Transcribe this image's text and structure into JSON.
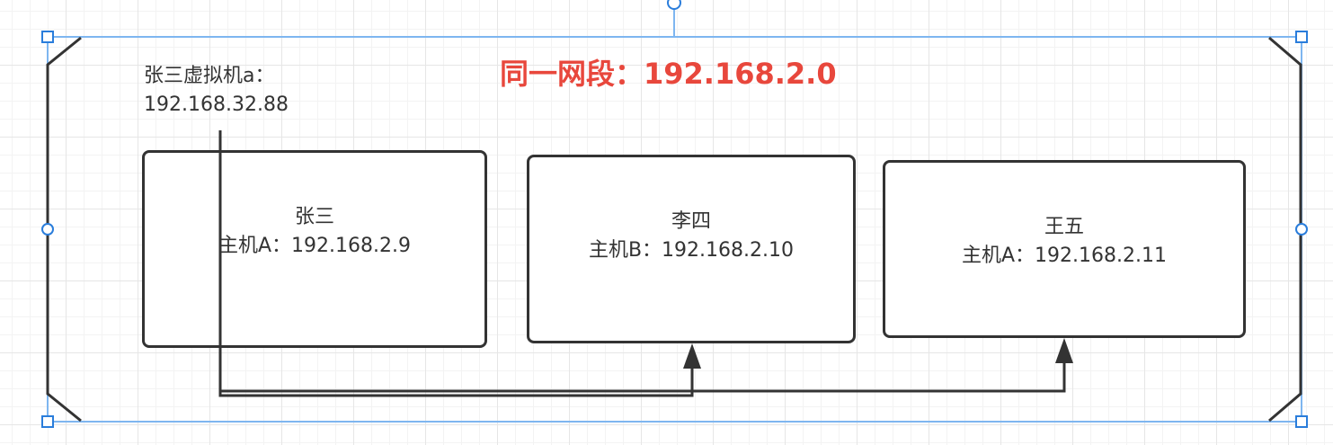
{
  "diagram": {
    "title": "同一网段：192.168.2.0",
    "vm_label": {
      "line1": "张三虚拟机a：",
      "line2": "192.168.32.88"
    },
    "hosts": [
      {
        "name": "张三",
        "address": "主机A：192.168.2.9"
      },
      {
        "name": "李四",
        "address": "主机B：192.168.2.10"
      },
      {
        "name": "王五",
        "address": "主机A：192.168.2.11"
      }
    ]
  },
  "colors": {
    "title": "#e8473c",
    "stroke": "#333333",
    "selection": "#7eb6f0",
    "handle": "#2a7ddb"
  }
}
